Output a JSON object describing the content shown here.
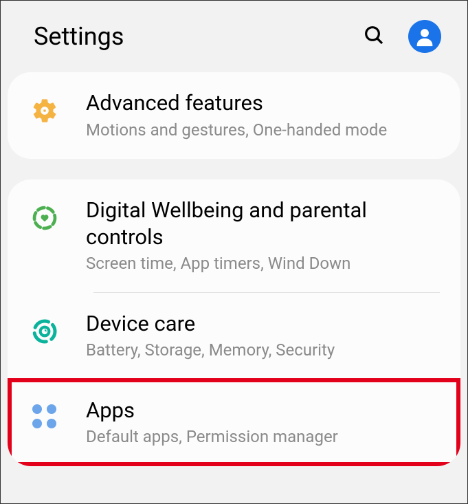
{
  "header": {
    "title": "Settings"
  },
  "group1": {
    "items": [
      {
        "title": "Advanced features",
        "subtitle": "Motions and gestures, One-handed mode"
      }
    ]
  },
  "group2": {
    "items": [
      {
        "title": "Digital Wellbeing and parental controls",
        "subtitle": "Screen time, App timers, Wind Down"
      },
      {
        "title": "Device care",
        "subtitle": "Battery, Storage, Memory, Security"
      },
      {
        "title": "Apps",
        "subtitle": "Default apps, Permission manager"
      }
    ]
  }
}
